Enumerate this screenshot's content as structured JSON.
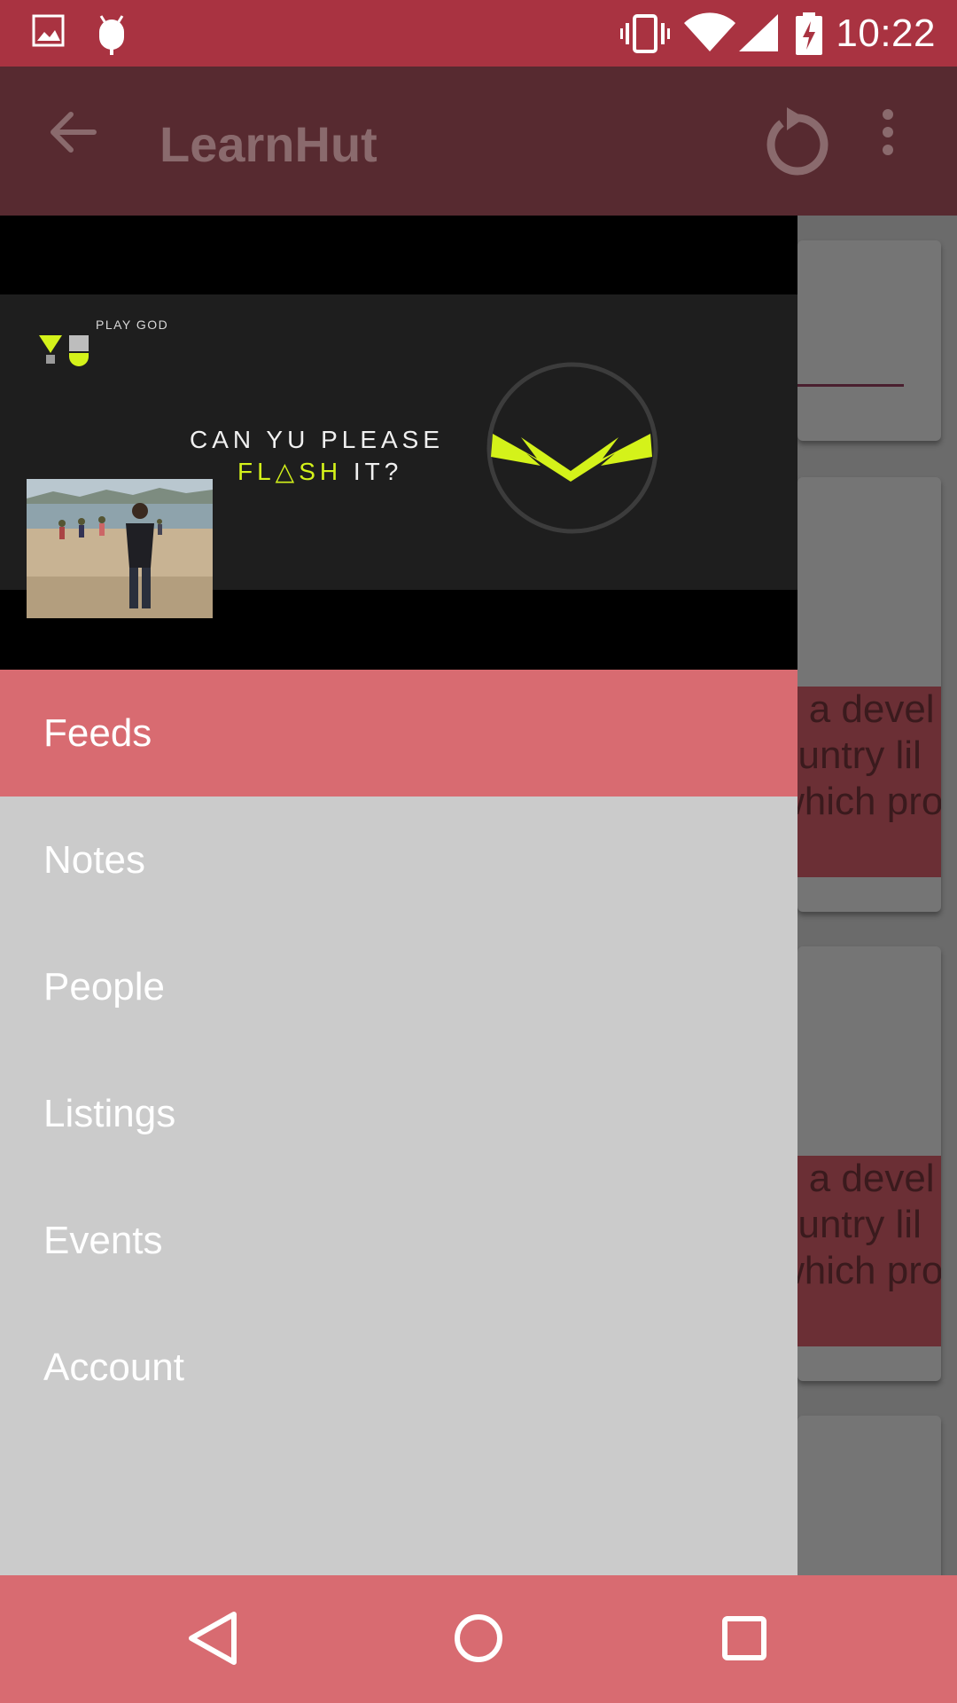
{
  "status_bar": {
    "time": "10:22",
    "icons": [
      "image-icon",
      "android-debug-icon",
      "vibrate-icon",
      "wifi-icon",
      "signal-icon",
      "battery-charging-icon"
    ]
  },
  "app_bar": {
    "title": "LearnHut",
    "icons": [
      "back-arrow-icon",
      "refresh-icon",
      "more-vert-icon"
    ]
  },
  "drawer": {
    "header": {
      "banner": {
        "brand": "PLAY GOD",
        "tagline_line1": "CAN YU PLEASE",
        "tagline_line2_highlight": "FL△SH",
        "tagline_line2_rest": " IT?"
      }
    },
    "menu": [
      {
        "label": "Feeds",
        "active": true
      },
      {
        "label": "Notes",
        "active": false
      },
      {
        "label": "People",
        "active": false
      },
      {
        "label": "Listings",
        "active": false
      },
      {
        "label": "Events",
        "active": false
      },
      {
        "label": "Account",
        "active": false
      }
    ]
  },
  "background_cards": [
    {
      "lines": [
        "n a devel",
        "ountry lil",
        "which pro"
      ]
    },
    {
      "lines": [
        "n a devel",
        "ountry lil",
        "which pro"
      ]
    }
  ],
  "colors": {
    "status_bar": "#a93341",
    "app_bar": "#572a30",
    "drawer_bg": "#cbcbcb",
    "active_item": "#d86b71",
    "nav_bar": "#d86b71",
    "accent_yellow": "#d4f21a"
  },
  "nav_bar": {
    "icons": [
      "back-triangle-icon",
      "home-circle-icon",
      "recents-square-icon"
    ]
  }
}
